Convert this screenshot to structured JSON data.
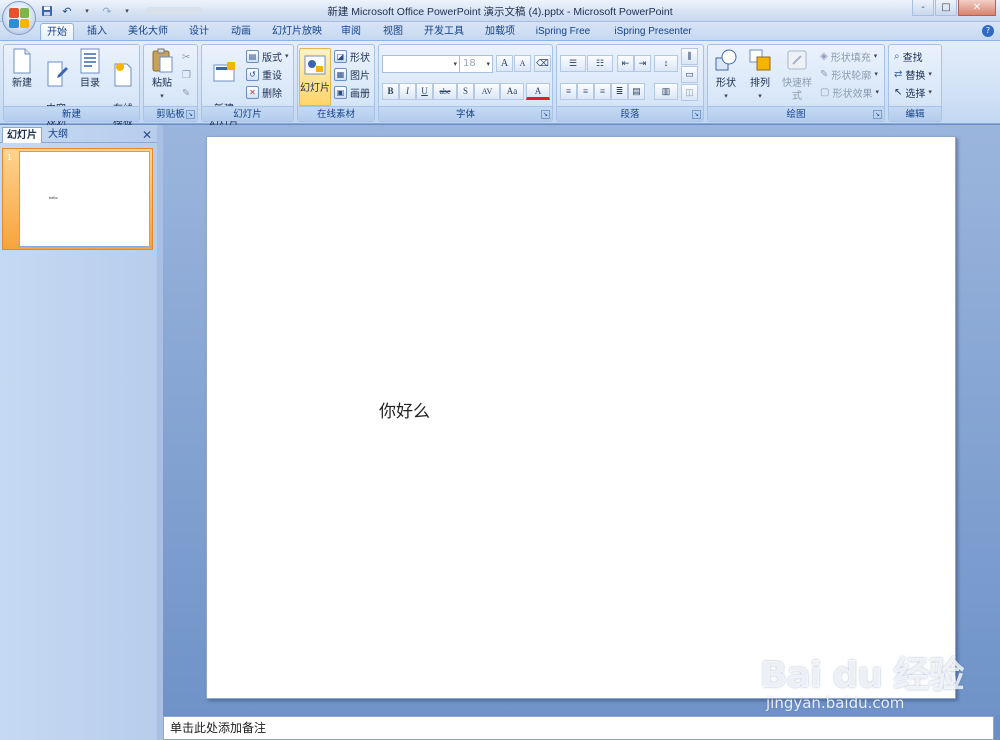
{
  "window": {
    "title": "新建 Microsoft Office PowerPoint 演示文稿 (4).pptx - Microsoft PowerPoint",
    "controls": [
      "-",
      "□",
      "✕"
    ]
  },
  "tabs": [
    {
      "label": "开始",
      "active": true
    },
    {
      "label": "插入"
    },
    {
      "label": "美化大师"
    },
    {
      "label": "设计"
    },
    {
      "label": "动画"
    },
    {
      "label": "幻灯片放映"
    },
    {
      "label": "审阅"
    },
    {
      "label": "视图"
    },
    {
      "label": "开发工具"
    },
    {
      "label": "加载项"
    },
    {
      "label": "iSpring Free"
    },
    {
      "label": "iSpring Presenter"
    }
  ],
  "ribbon": {
    "new_group": {
      "label": "新建",
      "buttons": [
        "新建",
        "内容\n规划",
        "目录",
        "在线\n模板"
      ]
    },
    "clipboard": {
      "label": "剪贴板",
      "paste": "粘贴"
    },
    "slides": {
      "label": "幻灯片",
      "new_slide": "新建\n幻灯片",
      "layout": "版式",
      "reset": "重设",
      "delete": "删除"
    },
    "online": {
      "label": "在线素材",
      "slide": "幻灯片",
      "shape": "形状",
      "picture": "图片",
      "album": "画册"
    },
    "font": {
      "label": "字体",
      "size": "18",
      "grow": "A",
      "shrink": "A",
      "bold": "B",
      "italic": "I",
      "underline": "U",
      "strike": "abe",
      "shadow": "S",
      "spacing": "AV",
      "case": "Aa",
      "color": "A"
    },
    "paragraph": {
      "label": "段落"
    },
    "drawing": {
      "label": "绘图",
      "shape": "形状",
      "arrange": "排列",
      "quick_styles": "快速样式",
      "fill": "形状填充",
      "outline": "形状轮廓",
      "effects": "形状效果"
    },
    "editing": {
      "label": "编辑",
      "find": "查找",
      "replace": "替换",
      "select": "选择"
    }
  },
  "left_pane": {
    "tabs": [
      "幻灯片",
      "大纲"
    ],
    "close": "✕",
    "thumb_number": "1",
    "thumb_text": "hello"
  },
  "slide": {
    "text": "你好么"
  },
  "notes": {
    "placeholder": "单击此处添加备注"
  },
  "watermark": {
    "logo": "Bai du 经验",
    "url": "jingyan.baidu.com"
  },
  "colors": {
    "ribbon_bg": "#cfe0f5",
    "workspace": "#6f93c8",
    "selected_thumb": "#f7a33b"
  }
}
